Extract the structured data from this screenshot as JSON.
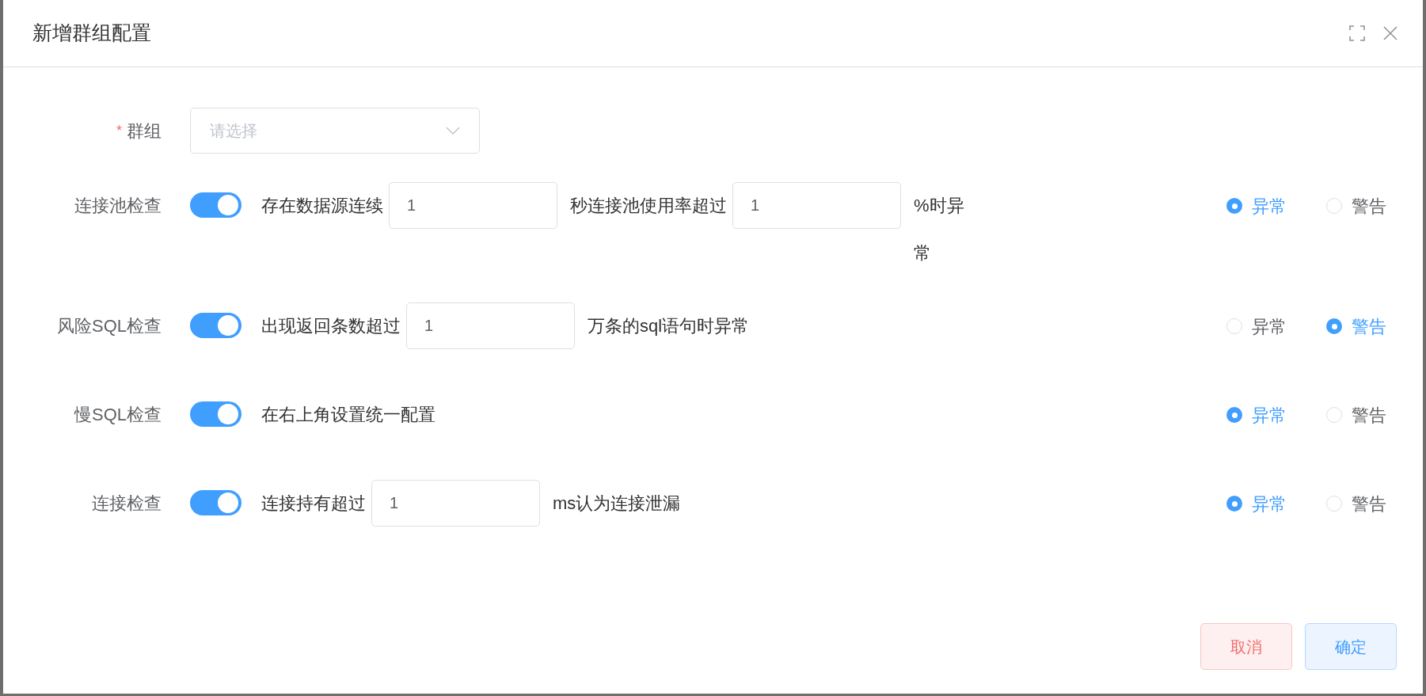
{
  "dialog": {
    "title": "新增群组配置"
  },
  "group_field": {
    "label": "群组",
    "required": true,
    "required_mark": "*",
    "placeholder": "请选择"
  },
  "checks": [
    {
      "label": "连接池检查",
      "on": true,
      "segments": [
        {
          "kind": "text",
          "text": "存在数据源连续"
        },
        {
          "kind": "input",
          "value": "1"
        },
        {
          "kind": "text",
          "text": "秒连接池使用率超过"
        },
        {
          "kind": "input",
          "value": "1"
        },
        {
          "kind": "text",
          "text": "%时异常"
        }
      ],
      "levels": [
        {
          "label": "异常",
          "selected": true
        },
        {
          "label": "警告",
          "selected": false
        }
      ]
    },
    {
      "label": "风险SQL检查",
      "on": true,
      "segments": [
        {
          "kind": "text",
          "text": "出现返回条数超过"
        },
        {
          "kind": "input",
          "value": "1"
        },
        {
          "kind": "text",
          "text": "万条的sql语句时异常"
        }
      ],
      "levels": [
        {
          "label": "异常",
          "selected": false
        },
        {
          "label": "警告",
          "selected": true
        }
      ]
    },
    {
      "label": "慢SQL检查",
      "on": true,
      "segments": [
        {
          "kind": "text",
          "text": "在右上角设置统一配置"
        }
      ],
      "levels": [
        {
          "label": "异常",
          "selected": true
        },
        {
          "label": "警告",
          "selected": false
        }
      ]
    },
    {
      "label": "连接检查",
      "on": true,
      "segments": [
        {
          "kind": "text",
          "text": "连接持有超过"
        },
        {
          "kind": "input",
          "value": "1"
        },
        {
          "kind": "text",
          "text": "ms认为连接泄漏"
        }
      ],
      "levels": [
        {
          "label": "异常",
          "selected": true
        },
        {
          "label": "警告",
          "selected": false
        }
      ]
    }
  ],
  "buttons": [
    {
      "label": "取消",
      "kind": "cancel"
    },
    {
      "label": "确定",
      "kind": "confirm"
    }
  ]
}
